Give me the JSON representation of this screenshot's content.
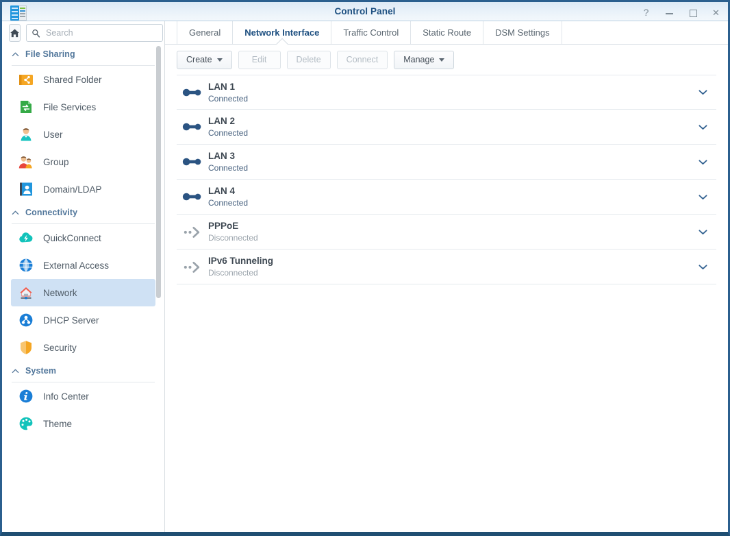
{
  "window": {
    "title": "Control Panel",
    "icon": "control-panel-icon",
    "controls": [
      {
        "name": "help-button",
        "glyph": "?"
      },
      {
        "name": "minimize-button",
        "glyph": "–"
      },
      {
        "name": "maximize-button",
        "glyph": "□"
      },
      {
        "name": "close-button",
        "glyph": "✕"
      }
    ]
  },
  "sidebar": {
    "home_button": "home-icon",
    "search": {
      "placeholder": "Search",
      "value": "",
      "icon": "search-icon"
    },
    "sections": [
      {
        "label": "File Sharing",
        "chevron": "chevron-up-icon",
        "items": [
          {
            "label": "Shared Folder",
            "icon": "shared-folder-icon",
            "selected": false
          },
          {
            "label": "File Services",
            "icon": "file-services-icon",
            "selected": false
          },
          {
            "label": "User",
            "icon": "user-icon",
            "selected": false
          },
          {
            "label": "Group",
            "icon": "group-icon",
            "selected": false
          },
          {
            "label": "Domain/LDAP",
            "icon": "domain-ldap-icon",
            "selected": false
          }
        ]
      },
      {
        "label": "Connectivity",
        "chevron": "chevron-up-icon",
        "items": [
          {
            "label": "QuickConnect",
            "icon": "quickconnect-icon",
            "selected": false
          },
          {
            "label": "External Access",
            "icon": "external-access-icon",
            "selected": false
          },
          {
            "label": "Network",
            "icon": "network-icon",
            "selected": true
          },
          {
            "label": "DHCP Server",
            "icon": "dhcp-server-icon",
            "selected": false
          },
          {
            "label": "Security",
            "icon": "security-icon",
            "selected": false
          }
        ]
      },
      {
        "label": "System",
        "chevron": "chevron-up-icon",
        "items": [
          {
            "label": "Info Center",
            "icon": "info-center-icon",
            "selected": false
          },
          {
            "label": "Theme",
            "icon": "theme-icon",
            "selected": false
          }
        ]
      }
    ]
  },
  "main": {
    "tabs": [
      {
        "label": "General",
        "active": false
      },
      {
        "label": "Network Interface",
        "active": true
      },
      {
        "label": "Traffic Control",
        "active": false
      },
      {
        "label": "Static Route",
        "active": false
      },
      {
        "label": "DSM Settings",
        "active": false
      }
    ],
    "toolbar": [
      {
        "label": "Create",
        "disabled": false,
        "dropdown": true
      },
      {
        "label": "Edit",
        "disabled": true,
        "dropdown": false
      },
      {
        "label": "Delete",
        "disabled": true,
        "dropdown": false
      },
      {
        "label": "Connect",
        "disabled": true,
        "dropdown": false
      },
      {
        "label": "Manage",
        "disabled": false,
        "dropdown": true
      }
    ],
    "interfaces": [
      {
        "name": "LAN 1",
        "status": "Connected",
        "connected": true,
        "icon": "link-connected-icon",
        "expander": "chevron-down-icon"
      },
      {
        "name": "LAN 2",
        "status": "Connected",
        "connected": true,
        "icon": "link-connected-icon",
        "expander": "chevron-down-icon"
      },
      {
        "name": "LAN 3",
        "status": "Connected",
        "connected": true,
        "icon": "link-connected-icon",
        "expander": "chevron-down-icon"
      },
      {
        "name": "LAN 4",
        "status": "Connected",
        "connected": true,
        "icon": "link-connected-icon",
        "expander": "chevron-down-icon"
      },
      {
        "name": "PPPoE",
        "status": "Disconnected",
        "connected": false,
        "icon": "link-disconnected-icon",
        "expander": "chevron-down-icon"
      },
      {
        "name": "IPv6 Tunneling",
        "status": "Disconnected",
        "connected": false,
        "icon": "link-disconnected-icon",
        "expander": "chevron-down-icon"
      }
    ]
  },
  "colors": {
    "window_border": "#2b5f8e",
    "title_text": "#1c4f80",
    "active_tab": "#1d4f80",
    "selected_nav_bg": "#cfe1f4",
    "connected_icon": "#2b5482",
    "disconnected_icon": "#9aa3ab"
  }
}
